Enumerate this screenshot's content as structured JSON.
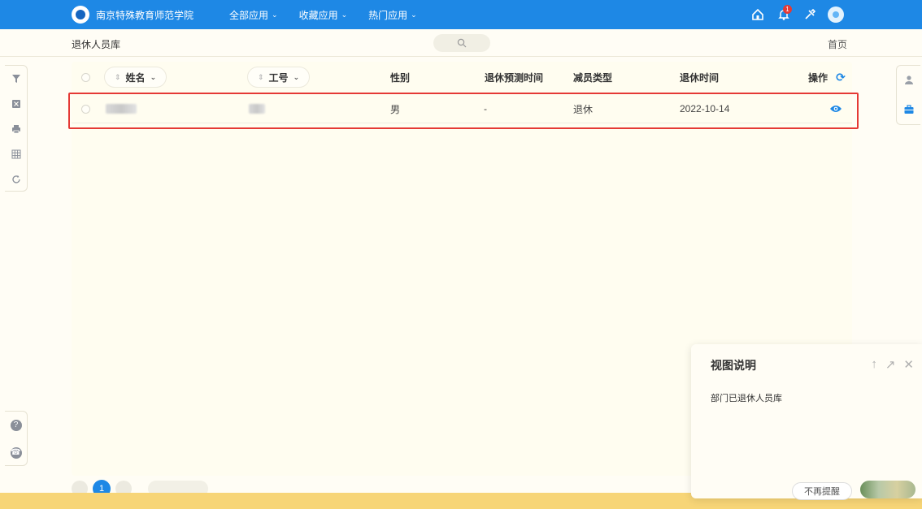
{
  "header": {
    "brand": "南京特殊教育师范学院",
    "menu": [
      {
        "label": "全部应用"
      },
      {
        "label": "收藏应用"
      },
      {
        "label": "热门应用"
      }
    ],
    "notification_count": "1"
  },
  "subheader": {
    "breadcrumb": "退休人员库",
    "home_link": "首页"
  },
  "table": {
    "columns": {
      "name": "姓名",
      "staff_id": "工号",
      "gender": "性别",
      "expected_retire_time": "退休预测时间",
      "reduction_type": "减员类型",
      "retire_time": "退休时间",
      "actions": "操作"
    },
    "rows": [
      {
        "gender": "男",
        "expected_retire_time": "-",
        "reduction_type": "退休",
        "retire_time": "2022-10-14"
      }
    ]
  },
  "pager": {
    "current_page": "1"
  },
  "popup": {
    "title": "视图说明",
    "body": "部门已退休人员库",
    "dismiss_label": "不再提醒"
  },
  "colors": {
    "primary": "#1e88e5",
    "highlight": "#e53935",
    "band": "#f7d577"
  }
}
